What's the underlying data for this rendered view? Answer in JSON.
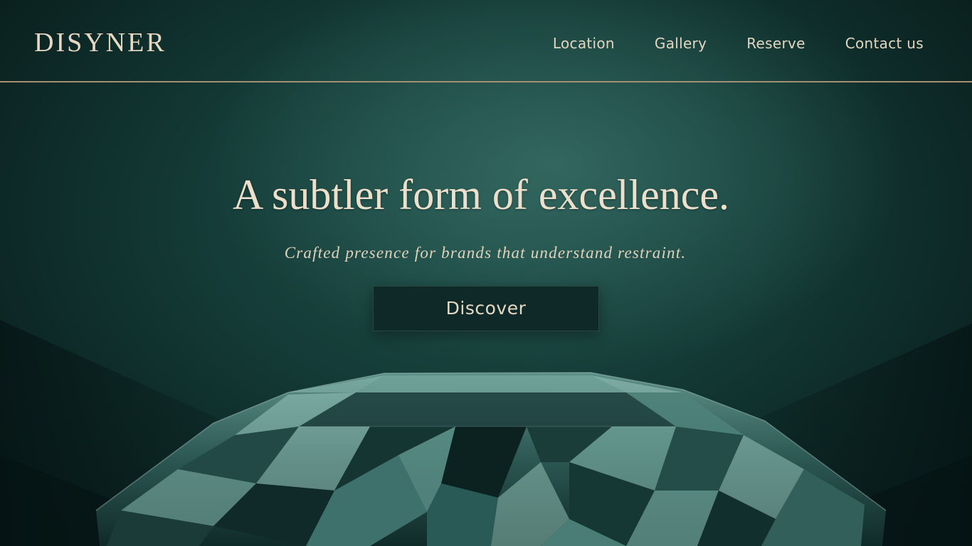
{
  "brand": {
    "logo_text": "DISYNER"
  },
  "nav": {
    "items": [
      {
        "label": "Location"
      },
      {
        "label": "Gallery"
      },
      {
        "label": "Reserve"
      },
      {
        "label": "Contact us"
      }
    ]
  },
  "hero": {
    "title": "A subtler form of excellence.",
    "subtitle": "Crafted presence for brands that understand restraint.",
    "cta_label": "Discover"
  },
  "colors": {
    "background": "#143b37",
    "accent_gold": "#a48f72",
    "text_cream": "#ecdfcb",
    "button_bg": "#0e2927"
  },
  "imagery": {
    "hero_object": "diamond"
  }
}
